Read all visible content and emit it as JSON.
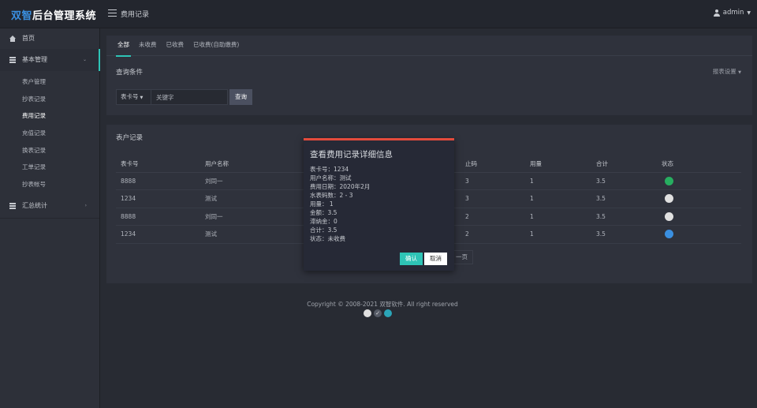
{
  "app": {
    "logo_part1": "双智",
    "logo_part2": "后台管理系统",
    "breadcrumb": "费用记录",
    "user": "admin"
  },
  "sidebar": {
    "home": "首页",
    "basic": "基本管理",
    "sub_items": [
      "表户管理",
      "抄表记录",
      "费用记录",
      "充值记录",
      "换表记录",
      "工单记录",
      "抄表帐号"
    ],
    "summary": "汇总统计"
  },
  "tabs": [
    "全部",
    "未收费",
    "已收费",
    "已收费(自助缴费)"
  ],
  "query": {
    "title": "查询条件",
    "report_settings": "报表设置",
    "select_value": "表卡号",
    "keyword_placeholder": "关键字",
    "search_button": "查询"
  },
  "records": {
    "title": "表户记录",
    "columns": [
      "表卡号",
      "用户名称",
      "",
      "",
      "止码",
      "用量",
      "合计",
      "状态"
    ],
    "rows": [
      {
        "card": "8888",
        "name": "刘同一",
        "end": "3",
        "usage": "1",
        "total": "3.5",
        "status_color": "#27ae60"
      },
      {
        "card": "1234",
        "name": "测试",
        "end": "3",
        "usage": "1",
        "total": "3.5",
        "status_color": "#e0e0e0"
      },
      {
        "card": "8888",
        "name": "刘同一",
        "end": "2",
        "usage": "1",
        "total": "3.5",
        "status_color": "#e0e0e0"
      },
      {
        "card": "1234",
        "name": "测试",
        "end": "2",
        "usage": "1",
        "total": "3.5",
        "status_color": "#3a8fe0"
      }
    ],
    "pager_text": "一页"
  },
  "footer": {
    "copyright": "Copyright © 2008-2021 双智软件. All right reserved",
    "icon_colors": [
      "#e0e0e0",
      "#555a66",
      "#2ba5b8"
    ]
  },
  "modal": {
    "title": "查看费用记录详细信息",
    "lines": [
      "表卡号：1234",
      "用户名称：测试",
      "费用日期：2020年2月",
      "水表码数：2 - 3",
      "用量： 1",
      "金额：3.5",
      "滞纳金：0",
      "合计：3.5",
      "状态：未收费"
    ],
    "confirm": "确认",
    "cancel": "取消"
  },
  "colors": {
    "accent": "#2ec4b6",
    "modal_top": "#e34b3c",
    "brand_blue": "#3a8fe0"
  }
}
